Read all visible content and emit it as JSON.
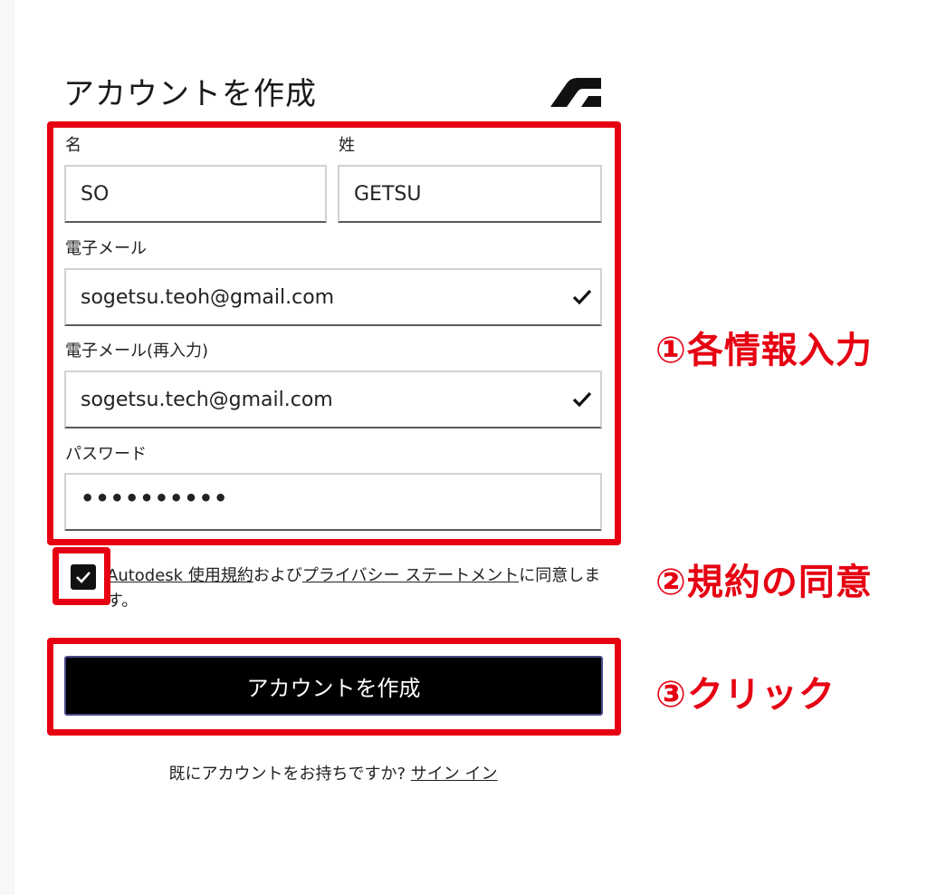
{
  "page_title": "アカウントを作成",
  "form": {
    "first_name": {
      "label": "名",
      "value": "SO"
    },
    "last_name": {
      "label": "姓",
      "value": "GETSU"
    },
    "email": {
      "label": "電子メール",
      "value": "sogetsu.teoh@gmail.com"
    },
    "email_confirm": {
      "label": "電子メール(再入力)",
      "value": "sogetsu.tech@gmail.com"
    },
    "password": {
      "label": "パスワード",
      "value": "••••••••••"
    }
  },
  "terms": {
    "checked": true,
    "link_terms": "Autodesk 使用規約",
    "text_and": "および",
    "link_privacy": "プライバシー ステートメント",
    "text_suffix": "に同意します。"
  },
  "submit_label": "アカウントを作成",
  "signin": {
    "prompt": "既にアカウントをお持ちですか? ",
    "link": "サイン イン"
  },
  "annotations": {
    "step1": "①各情報入力",
    "step2": "②規約の同意",
    "step3": "③クリック"
  },
  "colors": {
    "highlight": "#e60012",
    "button_bg": "#000000",
    "text": "#222222"
  },
  "icons": {
    "brand": "autodesk-logo-icon",
    "valid": "checkmark-icon",
    "checkbox": "checkbox-checked-icon"
  }
}
